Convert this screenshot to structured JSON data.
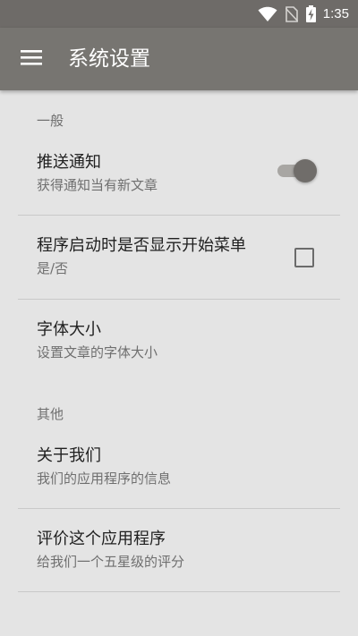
{
  "status_bar": {
    "time": "1:35",
    "icons": [
      "wifi-icon",
      "no-sim-icon",
      "battery-charging-icon"
    ],
    "background": "#6e6b68"
  },
  "app_bar": {
    "title": "系统设置",
    "menu_icon": "hamburger-menu-icon",
    "background": "#777571"
  },
  "sections": [
    {
      "header": "一般",
      "items": [
        {
          "title": "推送通知",
          "summary": "获得通知当有新文章",
          "widget": "switch",
          "checked": true
        },
        {
          "title": "程序启动时是否显示开始菜单",
          "summary": "是/否",
          "widget": "checkbox",
          "checked": false
        },
        {
          "title": "字体大小",
          "summary": "设置文章的字体大小",
          "widget": "none"
        }
      ]
    },
    {
      "header": "其他",
      "items": [
        {
          "title": "关于我们",
          "summary": "我们的应用程序的信息",
          "widget": "none"
        },
        {
          "title": "评价这个应用程序",
          "summary": "给我们一个五星级的评分",
          "widget": "none"
        }
      ]
    }
  ],
  "colors": {
    "background": "#e4e4e4",
    "accent": "#706d6a",
    "title_text": "#202020",
    "summary_text": "#6f6f6f",
    "divider": "#c9c9c9"
  }
}
